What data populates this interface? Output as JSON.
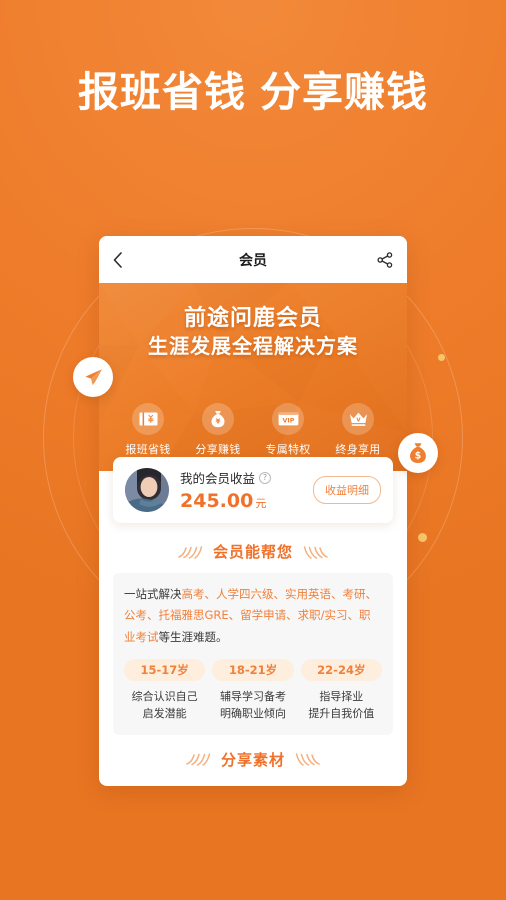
{
  "page": {
    "headline_part1": "报班省钱",
    "headline_part2": "分享赚钱",
    "background_color": "#ef7f2e",
    "accent_color": "#f0712a"
  },
  "navbar": {
    "back_icon": "chevron-left-icon",
    "title": "会员",
    "share_icon": "share-icon"
  },
  "hero": {
    "title_line1": "前途问鹿会员",
    "title_line2": "生涯发展全程解决方案",
    "features": [
      {
        "icon": "ticket-icon",
        "label": "报班省钱"
      },
      {
        "icon": "money-bag-icon",
        "label": "分享赚钱"
      },
      {
        "icon": "vip-card-icon",
        "label": "专属特权"
      },
      {
        "icon": "crown-icon",
        "label": "终身享用"
      }
    ]
  },
  "floating_badges": [
    {
      "icon": "paper-plane-icon",
      "position": "left"
    },
    {
      "icon": "money-bag-icon",
      "position": "right"
    }
  ],
  "earnings": {
    "avatar": "user-avatar",
    "label": "我的会员收益",
    "help_icon": "question-mark-icon",
    "amount": "245.00",
    "currency": "元",
    "detail_button": "收益明细"
  },
  "benefits": {
    "section_title": "会员能帮您",
    "paragraph_prefix": "一站式解决",
    "paragraph_highlight": "高考、人学四六级、实用英语、考研、公考、托福雅思GRE、留学申请、求职/实习、职业考试",
    "paragraph_suffix": "等生涯难题。",
    "age_groups": [
      {
        "range": "15-17岁",
        "desc_line1": "综合认识自己",
        "desc_line2": "启发潜能"
      },
      {
        "range": "18-21岁",
        "desc_line1": "辅导学习备考",
        "desc_line2": "明确职业倾向"
      },
      {
        "range": "22-24岁",
        "desc_line1": "指导择业",
        "desc_line2": "提升自我价值"
      }
    ]
  },
  "share_section": {
    "section_title": "分享素材"
  }
}
